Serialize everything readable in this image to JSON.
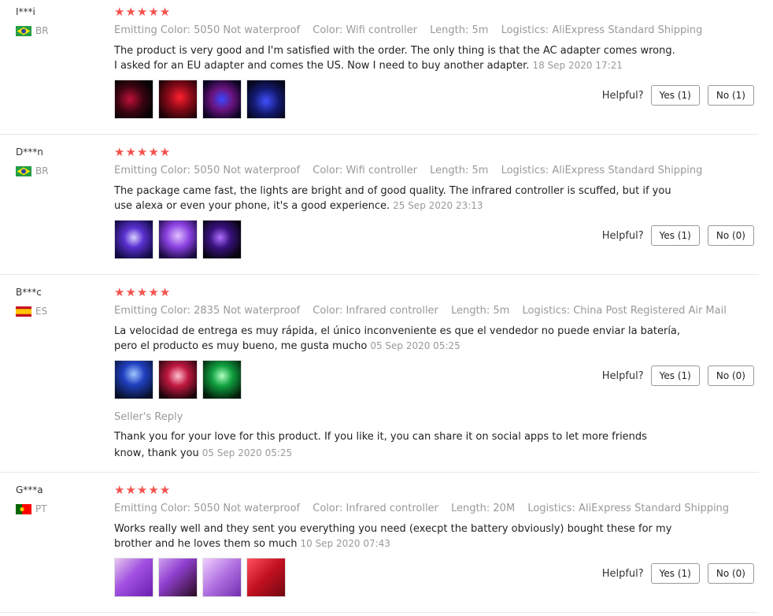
{
  "reviews": [
    {
      "user": "I***i",
      "country": "BR",
      "stars": "★★★★★",
      "emitting_color": "Emitting Color: 5050 Not waterproof",
      "color": "Color: Wifi controller",
      "length": "Length: 5m",
      "logistics": "Logistics: AliExpress Standard Shipping",
      "text": "The product is very good and I'm satisfied with the order. The only thing is that the AC adapter comes wrong. I asked for an EU adapter and comes the US. Now I need to buy another adapter.",
      "date": "18 Sep 2020 17:21",
      "helpful_label": "Helpful?",
      "yes_label": "Yes (1)",
      "no_label": "No (1)"
    },
    {
      "user": "D***n",
      "country": "BR",
      "stars": "★★★★★",
      "emitting_color": "Emitting Color: 5050 Not waterproof",
      "color": "Color: Wifi controller",
      "length": "Length: 5m",
      "logistics": "Logistics: AliExpress Standard Shipping",
      "text": "The package came fast, the lights are bright and of good quality. The infrared controller is scuffed, but if you use alexa or even your phone, it's a good experience.",
      "date": "25 Sep 2020 23:13",
      "helpful_label": "Helpful?",
      "yes_label": "Yes (1)",
      "no_label": "No (0)"
    },
    {
      "user": "B***c",
      "country": "ES",
      "stars": "★★★★★",
      "emitting_color": "Emitting Color: 2835 Not waterproof",
      "color": "Color: Infrared controller",
      "length": "Length: 5m",
      "logistics": "Logistics: China Post Registered Air Mail",
      "text": "La velocidad de entrega es muy rápida, el único inconveniente es que el vendedor no puede enviar la batería, pero el producto es muy bueno, me gusta mucho",
      "date": "05 Sep 2020 05:25",
      "helpful_label": "Helpful?",
      "yes_label": "Yes (1)",
      "no_label": "No (0)",
      "reply_label": "Seller's Reply",
      "reply_text": "Thank you for your love for this product. If you like it, you can share it on social apps to let more friends know, thank you",
      "reply_date": "05 Sep 2020 05:25"
    },
    {
      "user": "G***a",
      "country": "PT",
      "stars": "★★★★★",
      "emitting_color": "Emitting Color: 5050 Not waterproof",
      "color": "Color: Infrared controller",
      "length": "Length: 20M",
      "logistics": "Logistics: AliExpress Standard Shipping",
      "text": "Works really well and they sent you everything you need (execpt the battery obviously) bought these for my brother and he loves them so much",
      "date": "10 Sep 2020 07:43",
      "helpful_label": "Helpful?",
      "yes_label": "Yes (1)",
      "no_label": "No (0)"
    }
  ],
  "colors": {
    "star": "#f4524d",
    "muted": "#999999",
    "divider": "#e8e8e8"
  }
}
